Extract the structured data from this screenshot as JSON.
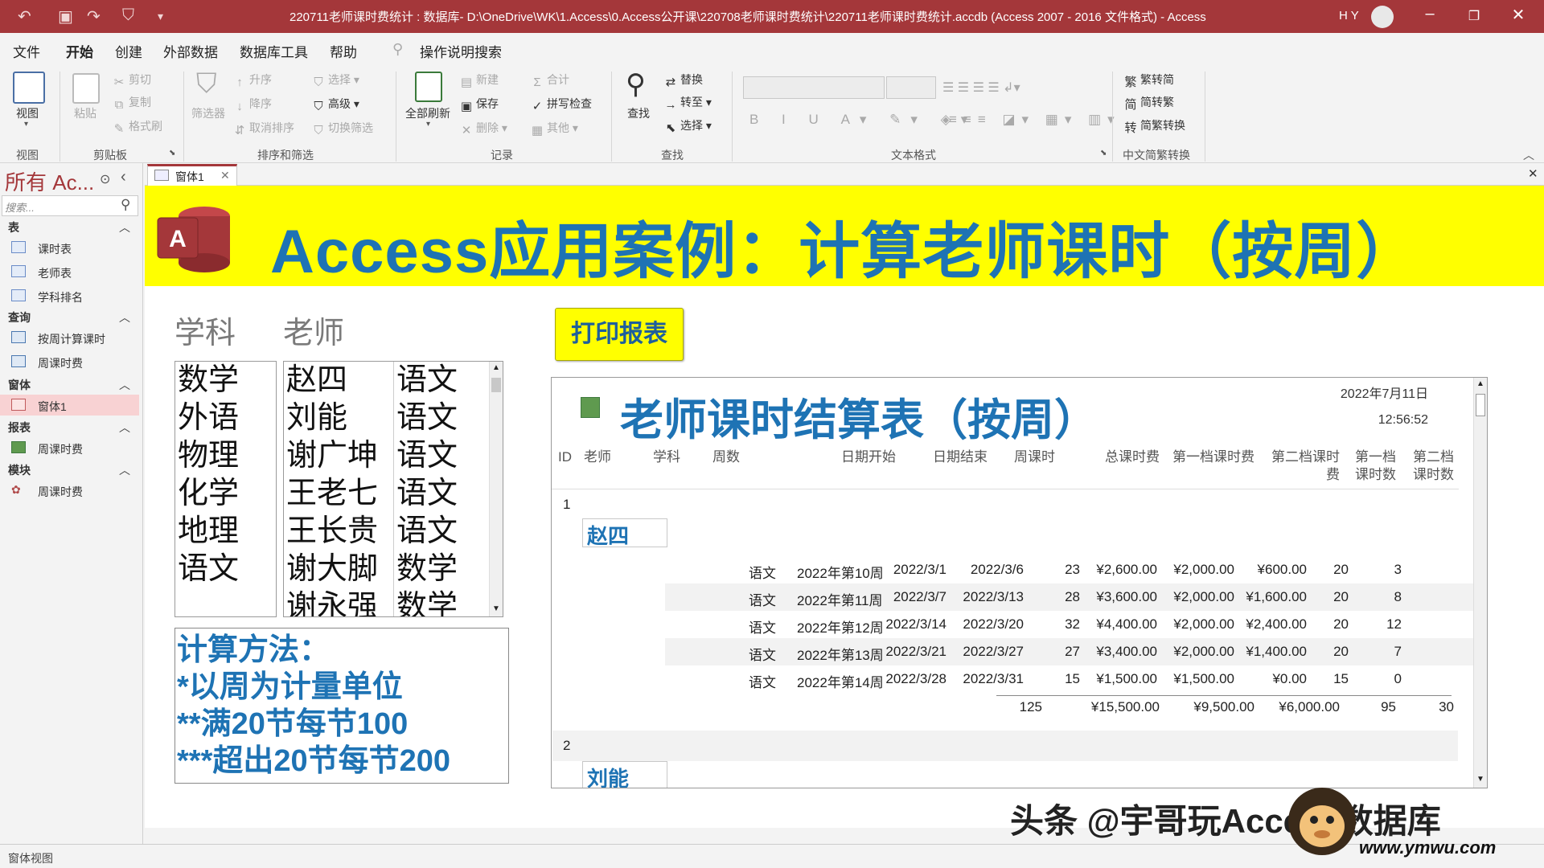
{
  "window": {
    "title": "220711老师课时费统计 : 数据库- D:\\OneDrive\\WK\\1.Access\\0.Access公开课\\220708老师课时费统计\\220711老师课时费统计.accdb (Access 2007 - 2016 文件格式) - Access",
    "user": "H Y",
    "accent_color": "#a4373a"
  },
  "menu": [
    "文件",
    "开始",
    "创建",
    "外部数据",
    "数据库工具",
    "帮助",
    "操作说明搜索"
  ],
  "ribbon": {
    "view": "视图",
    "paste": "粘贴",
    "cut": "剪切",
    "copy": "复制",
    "format_painter": "格式刷",
    "filter": "筛选器",
    "asc": "升序",
    "desc": "降序",
    "clear_sort": "取消排序",
    "select": "选择",
    "advanced": "高级",
    "toggle_filter": "切换筛选",
    "refresh_all": "全部刷新",
    "new": "新建",
    "save": "保存",
    "delete": "删除",
    "totals": "合计",
    "spelling": "拼写检查",
    "more": "其他",
    "find": "查找",
    "replace": "替换",
    "goto": "转至",
    "select2": "选择",
    "trad_to_simp": "繁转简",
    "simp_to_trad": "简转繁",
    "conv": "简繁转换",
    "groups": [
      "视图",
      "剪贴板",
      "排序和筛选",
      "记录",
      "查找",
      "文本格式",
      "中文简繁转换"
    ]
  },
  "nav": {
    "header": "所有 Ac...",
    "search_placeholder": "搜索...",
    "sections": [
      {
        "name": "表",
        "items": [
          "课时表",
          "老师表",
          "学科排名"
        ]
      },
      {
        "name": "查询",
        "items": [
          "按周计算课时",
          "周课时费"
        ]
      },
      {
        "name": "窗体",
        "items": [
          "窗体1"
        ]
      },
      {
        "name": "报表",
        "items": [
          "周课时费"
        ]
      },
      {
        "name": "模块",
        "items": [
          "周课时费"
        ]
      }
    ]
  },
  "tab": {
    "label": "窗体1"
  },
  "form": {
    "banner_title": "Access应用案例：计算老师课时（按周）",
    "subject_label": "学科",
    "teacher_label": "老师",
    "subjects": [
      "数学",
      "外语",
      "物理",
      "化学",
      "地理",
      "语文"
    ],
    "teachers": [
      {
        "name": "赵四",
        "subject": "语文"
      },
      {
        "name": "刘能",
        "subject": "语文"
      },
      {
        "name": "谢广坤",
        "subject": "语文"
      },
      {
        "name": "王老七",
        "subject": "语文"
      },
      {
        "name": "王长贵",
        "subject": "语文"
      },
      {
        "name": "谢大脚",
        "subject": "数学"
      },
      {
        "name": "谢永强",
        "subject": "数学"
      }
    ],
    "calc_lines": [
      "计算方法：",
      "*以周为计量单位",
      "**满20节每节100",
      "***超出20节每节200"
    ],
    "print_button": "打印报表",
    "banner_color": "#ffff00",
    "title_color": "#1e73b4"
  },
  "report": {
    "title": "老师课时结算表（按周）",
    "date": "2022年7月11日",
    "time": "12:56:52",
    "columns": [
      "ID",
      "老师",
      "学科",
      "周数",
      "日期开始",
      "日期结束",
      "周课时",
      "总课时费",
      "第一档课时费",
      "第二档课时费",
      "第一档课时数",
      "第二档课时数"
    ],
    "groups": [
      {
        "id": "1",
        "teacher": "赵四",
        "rows": [
          {
            "subject": "语文",
            "week": "2022年第10周",
            "start": "2022/3/1",
            "end": "2022/3/6",
            "hours": "23",
            "total": "¥2,600.00",
            "fee1": "¥2,000.00",
            "fee2": "¥600.00",
            "h1": "20",
            "h2": "3"
          },
          {
            "subject": "语文",
            "week": "2022年第11周",
            "start": "2022/3/7",
            "end": "2022/3/13",
            "hours": "28",
            "total": "¥3,600.00",
            "fee1": "¥2,000.00",
            "fee2": "¥1,600.00",
            "h1": "20",
            "h2": "8"
          },
          {
            "subject": "语文",
            "week": "2022年第12周",
            "start": "2022/3/14",
            "end": "2022/3/20",
            "hours": "32",
            "total": "¥4,400.00",
            "fee1": "¥2,000.00",
            "fee2": "¥2,400.00",
            "h1": "20",
            "h2": "12"
          },
          {
            "subject": "语文",
            "week": "2022年第13周",
            "start": "2022/3/21",
            "end": "2022/3/27",
            "hours": "27",
            "total": "¥3,400.00",
            "fee1": "¥2,000.00",
            "fee2": "¥1,400.00",
            "h1": "20",
            "h2": "7"
          },
          {
            "subject": "语文",
            "week": "2022年第14周",
            "start": "2022/3/28",
            "end": "2022/3/31",
            "hours": "15",
            "total": "¥1,500.00",
            "fee1": "¥1,500.00",
            "fee2": "¥0.00",
            "h1": "15",
            "h2": "0"
          }
        ],
        "totals": {
          "hours": "125",
          "total": "¥15,500.00",
          "fee1": "¥9,500.00",
          "fee2": "¥6,000.00",
          "h1": "95",
          "h2": "30"
        }
      },
      {
        "id": "2",
        "teacher": "刘能"
      }
    ]
  },
  "status": "窗体视图",
  "watermark": {
    "text": "头条 @宇哥玩Access数据库",
    "url": "www.ymwu.com"
  }
}
